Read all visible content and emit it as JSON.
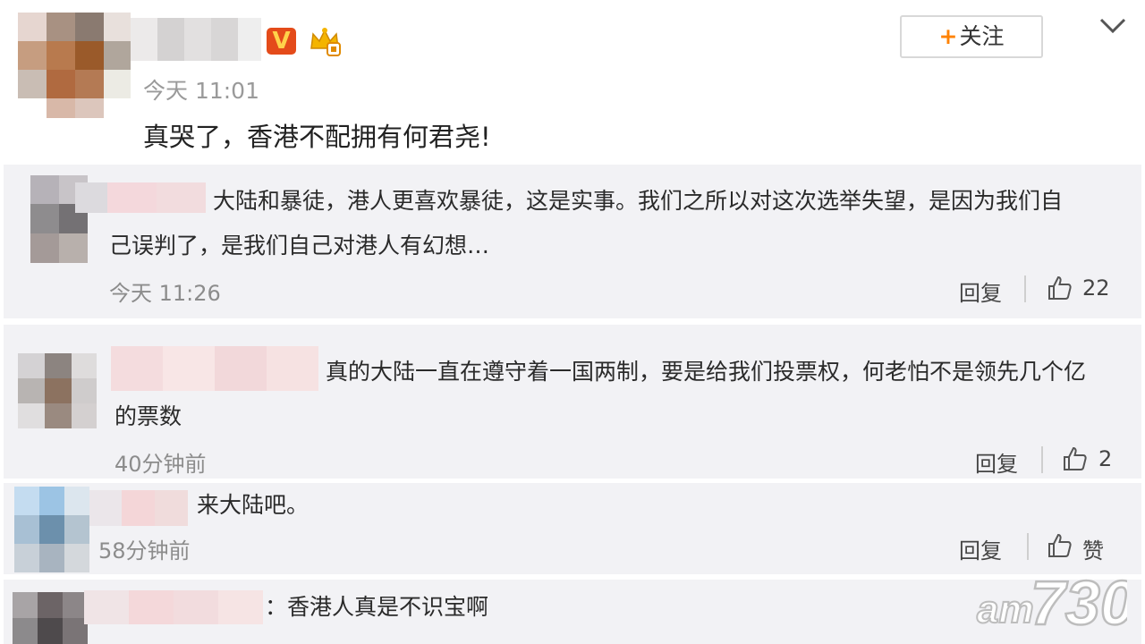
{
  "post": {
    "timestamp": "今天 11:01",
    "text": "真哭了，香港不配拥有何君尧!",
    "verified_badge": "V",
    "follow_button": {
      "plus": "+",
      "label": "关注"
    }
  },
  "comments": [
    {
      "text": "大陆和暴徒，港人更喜欢暴徒，这是实事。我们之所以对这次选举失望，是因为我们自己误判了，是我们自己对港人有幻想…",
      "line1": "大陆和暴徒，港人更喜欢暴徒，这是实事。我们之所以对这次选举失望，是因为我们自",
      "line2": "己误判了，是我们自己对港人有幻想…",
      "timestamp": "今天 11:26",
      "reply_label": "回复",
      "likes": "22"
    },
    {
      "text": "真的大陆一直在遵守着一国两制，要是给我们投票权，何老怕不是领先几个亿的票数",
      "line1": "真的大陆一直在遵守着一国两制，要是给我们投票权，何老怕不是领先几个亿",
      "line2": "的票数",
      "timestamp": "40分钟前",
      "reply_label": "回复",
      "likes": "2"
    },
    {
      "text": "来大陆吧。",
      "timestamp": "58分钟前",
      "reply_label": "回复",
      "likes": "赞"
    },
    {
      "text": "：香港人真是不识宝啊"
    }
  ],
  "watermark": "am730",
  "colors": {
    "follow_plus": "#ff8200",
    "verified": "#e44b1a",
    "panel_bg": "#f2f2f5"
  },
  "icons": [
    "chevron-down-icon",
    "thumbs-up-icon",
    "crown-icon",
    "verified-v-icon"
  ]
}
